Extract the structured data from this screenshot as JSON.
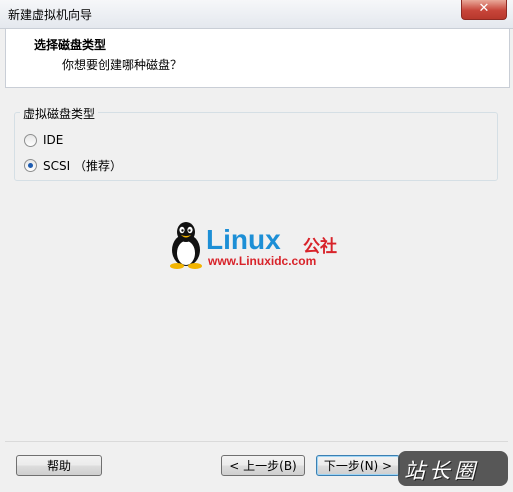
{
  "window": {
    "title": "新建虚拟机向导"
  },
  "header": {
    "title": "选择磁盘类型",
    "subtitle": "你想要创建哪种磁盘？"
  },
  "group": {
    "legend": "虚拟磁盘类型",
    "options": [
      {
        "label": "IDE",
        "checked": false
      },
      {
        "label": "SCSI （推荐）",
        "checked": true
      }
    ]
  },
  "logo": {
    "brand": "Linux",
    "brand_cn": "公社",
    "url": "www.Linuxidc.com"
  },
  "buttons": {
    "help": "帮助",
    "back": "< 上一步(B)",
    "next": "下一步(N) >"
  },
  "watermark": {
    "text": "站长圈"
  },
  "colors": {
    "accent": "#1d8fd6",
    "brand_red": "#d8232a",
    "close": "#c7453a"
  }
}
